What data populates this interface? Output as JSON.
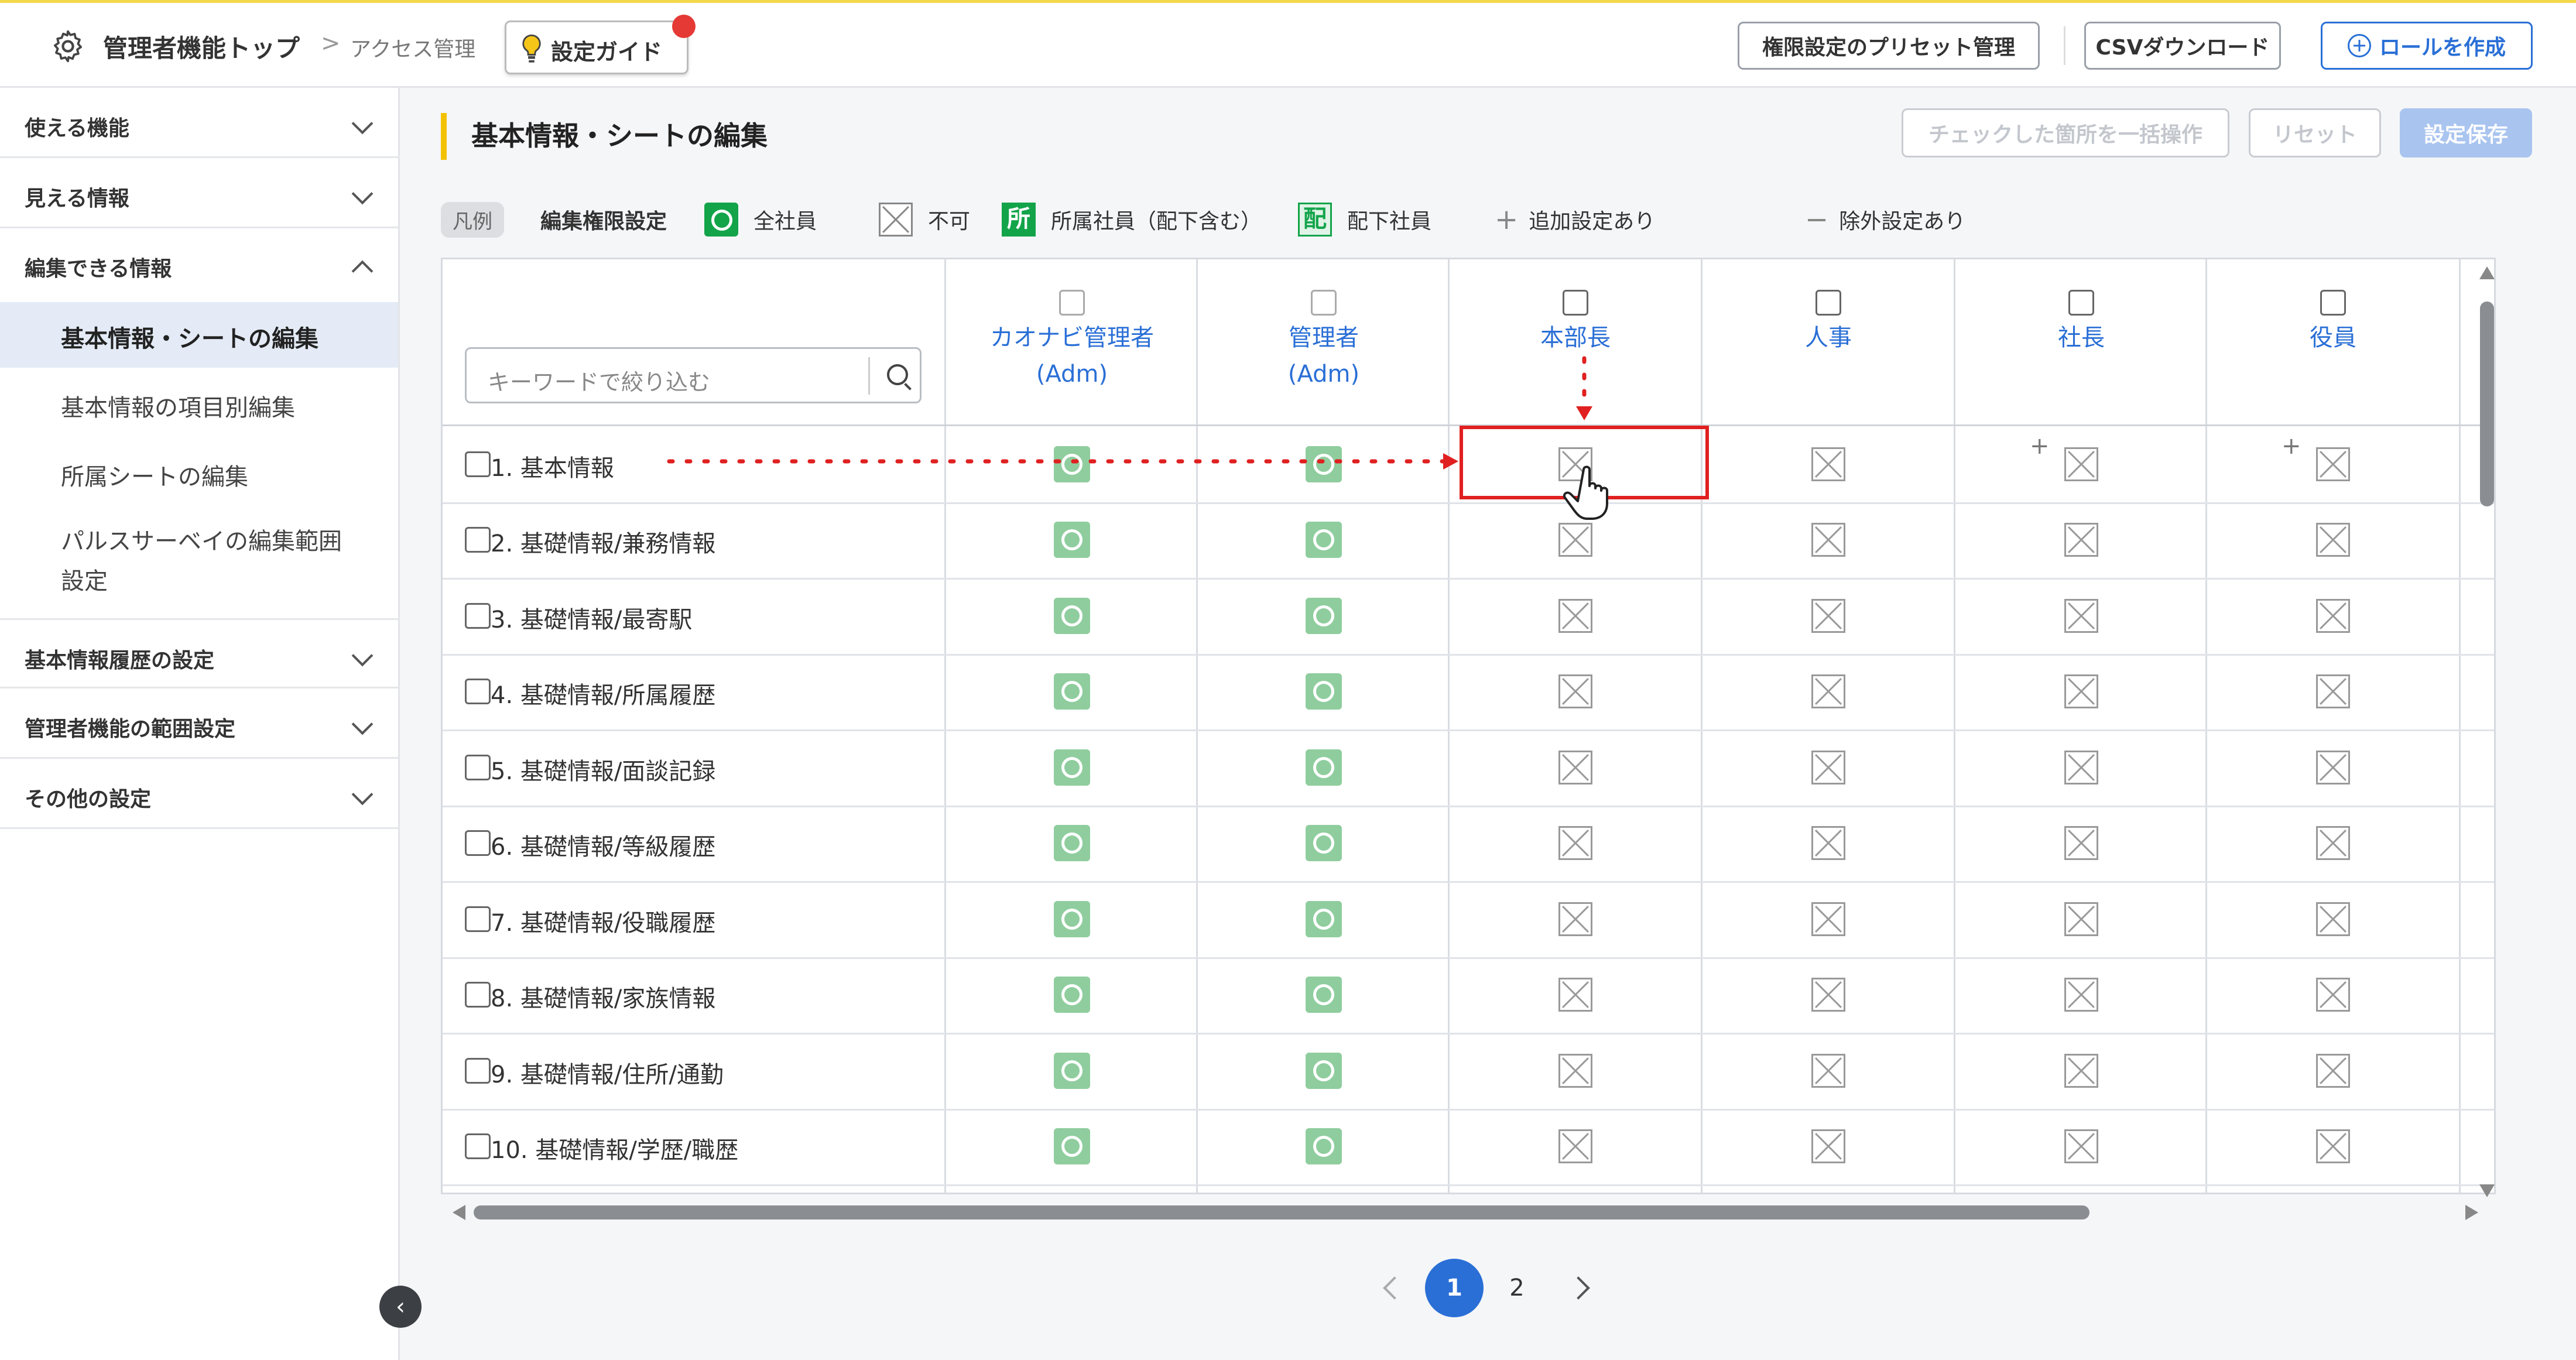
{
  "header": {
    "breadcrumb_main": "管理者機能トップ",
    "breadcrumb_sep": ">",
    "breadcrumb_sub": "アクセス管理",
    "guide_label": "設定ガイド",
    "preset_label": "権限設定のプリセット管理",
    "csv_label": "CSVダウンロード",
    "create_role_label": "ロールを作成"
  },
  "sidebar": {
    "sections": [
      {
        "label": "使える機能",
        "expanded": false
      },
      {
        "label": "見える情報",
        "expanded": false
      },
      {
        "label": "編集できる情報",
        "expanded": true
      },
      {
        "label": "基本情報履歴の設定",
        "expanded": false
      },
      {
        "label": "管理者機能の範囲設定",
        "expanded": false
      },
      {
        "label": "その他の設定",
        "expanded": false
      }
    ],
    "subitems": [
      {
        "label": "基本情報・シートの編集",
        "active": true
      },
      {
        "label": "基本情報の項目別編集",
        "active": false
      },
      {
        "label": "所属シートの編集",
        "active": false
      },
      {
        "label": "パルスサーベイの編集範囲",
        "label2": "設定",
        "active": false
      }
    ]
  },
  "main": {
    "title": "基本情報・シートの編集",
    "bulk_label": "チェックした箇所を一括操作",
    "reset_label": "リセット",
    "save_label": "設定保存",
    "search_placeholder": "キーワードで絞り込む"
  },
  "legend": {
    "tag": "凡例",
    "heading": "編集権限設定",
    "all_label": "全社員",
    "no_label": "不可",
    "dept_glyph": "所",
    "dept_label": "所属社員（配下含む）",
    "sub_glyph": "配",
    "sub_label": "配下社員",
    "add_label": "追加設定あり",
    "exclude_label": "除外設定あり"
  },
  "columns": [
    {
      "name": "カオナビ管理者",
      "name2": "(Adm)",
      "disabled": true
    },
    {
      "name": "管理者",
      "name2": "(Adm)",
      "disabled": true
    },
    {
      "name": "本部長",
      "name2": "",
      "disabled": false
    },
    {
      "name": "人事",
      "name2": "",
      "disabled": false
    },
    {
      "name": "社長",
      "name2": "",
      "disabled": false
    },
    {
      "name": "役員",
      "name2": "",
      "disabled": false
    }
  ],
  "rows": [
    {
      "label": "1. 基本情報",
      "cells": [
        "ok",
        "ok",
        "x",
        "x",
        "x+",
        "x+"
      ]
    },
    {
      "label": "2. 基礎情報/兼務情報",
      "cells": [
        "ok",
        "ok",
        "x",
        "x",
        "x",
        "x"
      ]
    },
    {
      "label": "3. 基礎情報/最寄駅",
      "cells": [
        "ok",
        "ok",
        "x",
        "x",
        "x",
        "x"
      ]
    },
    {
      "label": "4. 基礎情報/所属履歴",
      "cells": [
        "ok",
        "ok",
        "x",
        "x",
        "x",
        "x"
      ]
    },
    {
      "label": "5. 基礎情報/面談記録",
      "cells": [
        "ok",
        "ok",
        "x",
        "x",
        "x",
        "x"
      ]
    },
    {
      "label": "6. 基礎情報/等級履歴",
      "cells": [
        "ok",
        "ok",
        "x",
        "x",
        "x",
        "x"
      ]
    },
    {
      "label": "7. 基礎情報/役職履歴",
      "cells": [
        "ok",
        "ok",
        "x",
        "x",
        "x",
        "x"
      ]
    },
    {
      "label": "8. 基礎情報/家族情報",
      "cells": [
        "ok",
        "ok",
        "x",
        "x",
        "x",
        "x"
      ]
    },
    {
      "label": "9. 基礎情報/住所/通勤",
      "cells": [
        "ok",
        "ok",
        "x",
        "x",
        "x",
        "x"
      ]
    },
    {
      "label": "10. 基礎情報/学歴/職歴",
      "cells": [
        "ok",
        "ok",
        "x",
        "x",
        "x",
        "x"
      ]
    }
  ],
  "pagination": {
    "pages": [
      "1",
      "2"
    ],
    "current": "1"
  },
  "colors": {
    "accent": "#2a6fd6",
    "ok_green": "#13a44a",
    "highlight_red": "#e02020",
    "title_bar": "#f2c200"
  }
}
